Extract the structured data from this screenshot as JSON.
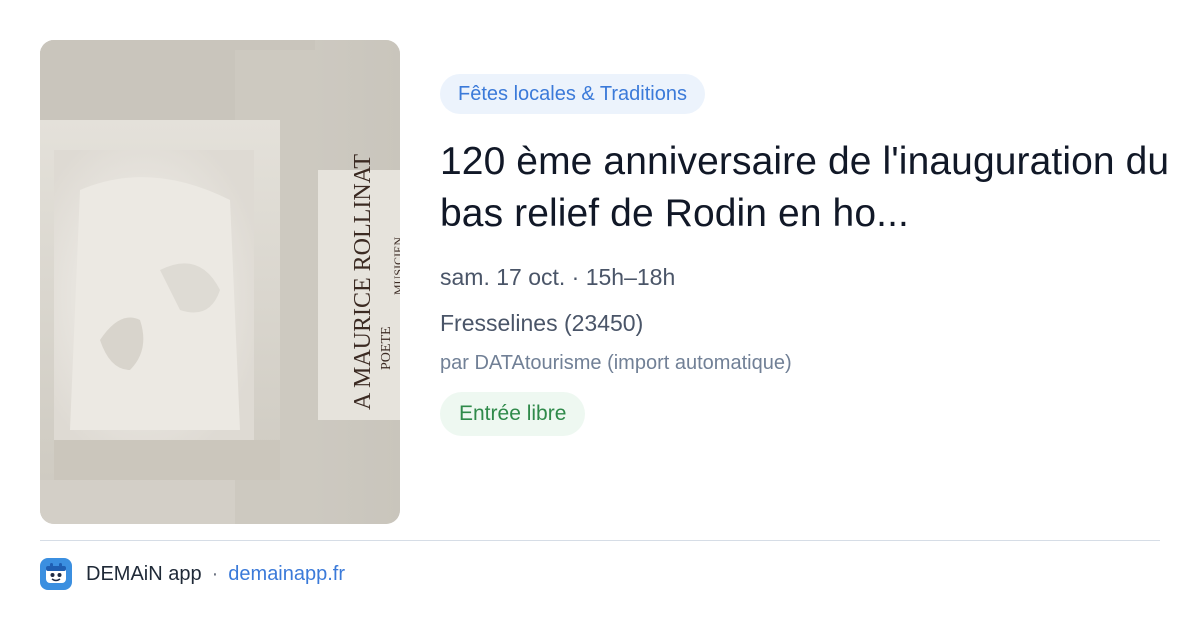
{
  "card": {
    "category": "Fêtes locales & Traditions",
    "title": "120 ème anniversaire de l'inauguration du bas relief de Rodin en ho...",
    "date": "sam. 17 oct. · 15h–18h",
    "location": "Fresselines (23450)",
    "source": "par DATAtourisme (import automatique)",
    "price": "Entrée libre",
    "image": {
      "plaque_line1": "A MAURICE ROLLINAT",
      "plaque_line2": "POETE",
      "plaque_line3": "MUSICIEN"
    }
  },
  "footer": {
    "app_name": "DEMAiN app",
    "separator": "·",
    "url": "demainapp.fr",
    "icon": "demain-app-icon"
  },
  "colors": {
    "accent_blue": "#3b7ad9",
    "category_bg": "#ecf3fc",
    "price_green": "#2f8a4a",
    "price_bg": "#eef8f1"
  }
}
